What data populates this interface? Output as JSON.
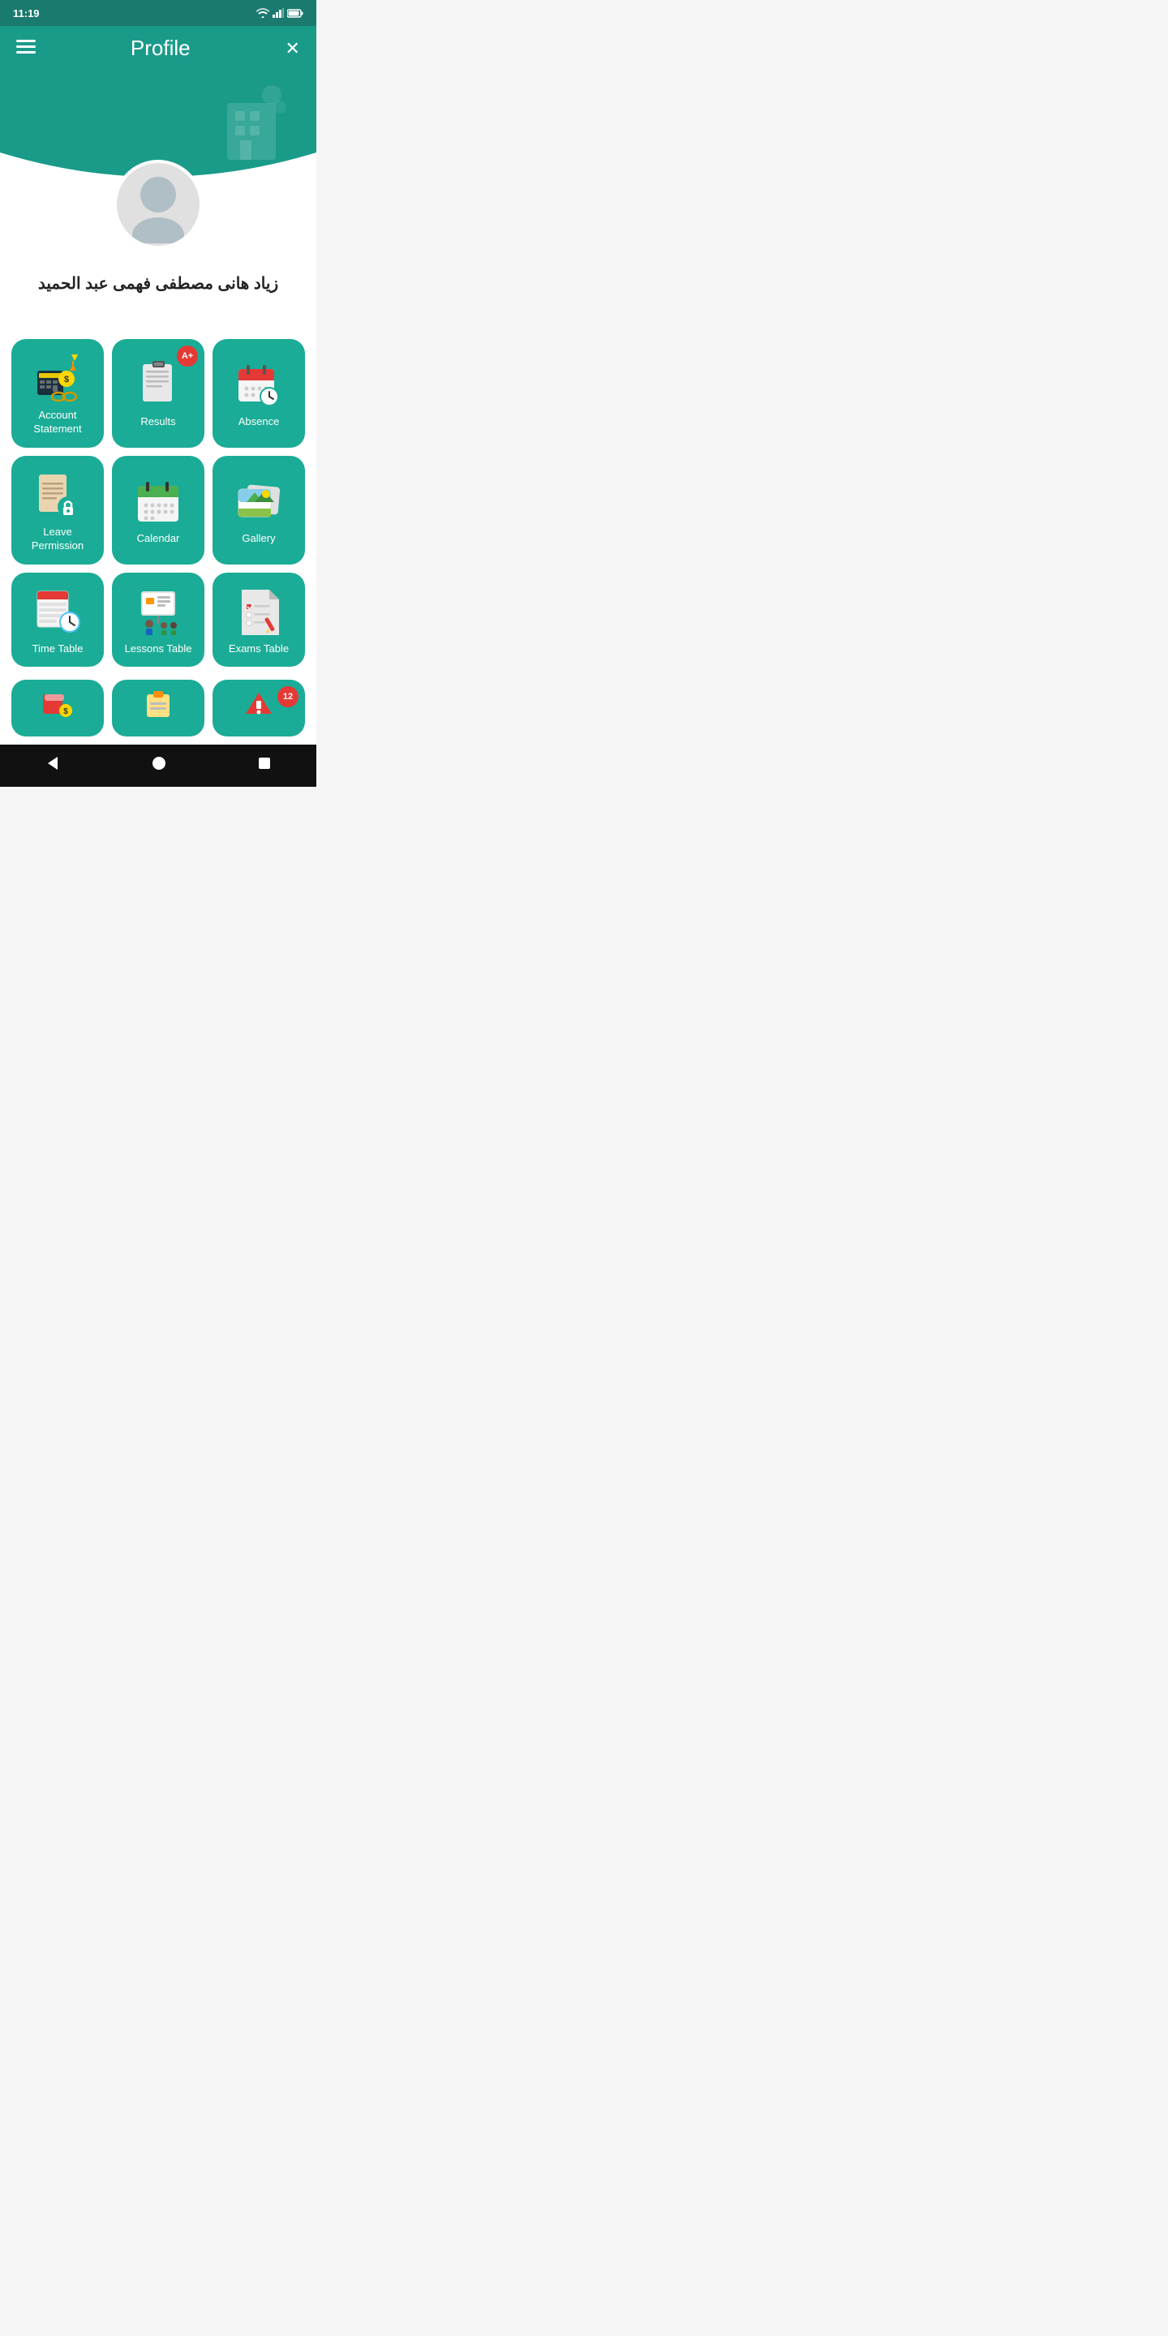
{
  "statusBar": {
    "time": "11:19"
  },
  "header": {
    "title": "Profile",
    "menuIcon": "≡",
    "closeIcon": "✕"
  },
  "user": {
    "name": "زياد هانى مصطفى فهمى عبد الحميد"
  },
  "grid": {
    "items": [
      {
        "id": "account-statement",
        "label": "Account\nStatement",
        "badge": null,
        "iconType": "account"
      },
      {
        "id": "results",
        "label": "Results",
        "badge": "A+",
        "iconType": "results"
      },
      {
        "id": "absence",
        "label": "Absence",
        "badge": null,
        "iconType": "absence"
      },
      {
        "id": "leave-permission",
        "label": "Leave\nPermission",
        "badge": null,
        "iconType": "leave"
      },
      {
        "id": "calendar",
        "label": "Calendar",
        "badge": null,
        "iconType": "calendar"
      },
      {
        "id": "gallery",
        "label": "Gallery",
        "badge": null,
        "iconType": "gallery"
      },
      {
        "id": "time-table",
        "label": "Time Table",
        "badge": null,
        "iconType": "timetable"
      },
      {
        "id": "lessons-table",
        "label": "Lessons Table",
        "badge": null,
        "iconType": "lessons"
      },
      {
        "id": "exams-table",
        "label": "Exams Table",
        "badge": null,
        "iconType": "exams"
      }
    ],
    "partialItems": [
      {
        "id": "partial-1",
        "badge": null,
        "iconType": "coins"
      },
      {
        "id": "partial-2",
        "badge": null,
        "iconType": "clipboard"
      },
      {
        "id": "partial-3",
        "badge": "12",
        "iconType": "notification"
      }
    ]
  },
  "navBar": {
    "back": "◀",
    "home": "●",
    "square": "■"
  }
}
